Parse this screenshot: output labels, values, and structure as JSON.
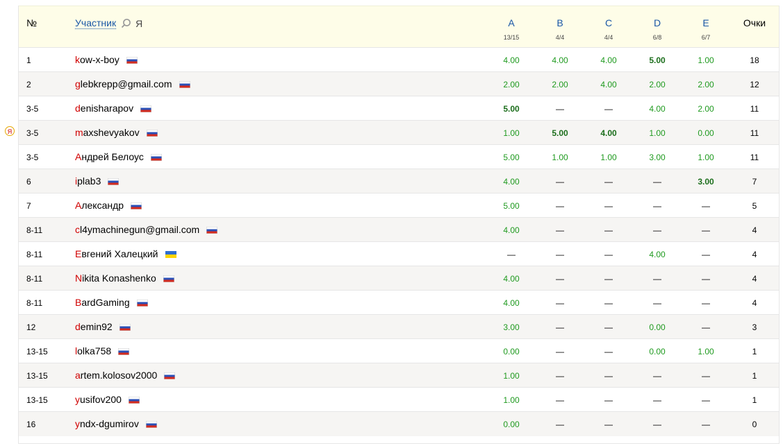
{
  "header": {
    "num_label": "№",
    "participant_label": "Участник",
    "me_label": "Я",
    "score_label": "Очки",
    "problems": [
      {
        "letter": "A",
        "stat": "13/15"
      },
      {
        "letter": "B",
        "stat": "4/4"
      },
      {
        "letter": "C",
        "stat": "4/4"
      },
      {
        "letter": "D",
        "stat": "6/8"
      },
      {
        "letter": "E",
        "stat": "6/7"
      }
    ]
  },
  "me_marker": "Я",
  "rows": [
    {
      "rank": "1",
      "first": "k",
      "rest": "ow-x-boy",
      "flag": "ru",
      "scores": [
        "4.00",
        "4.00",
        "4.00",
        "5.00",
        "1.00"
      ],
      "best": [
        false,
        false,
        false,
        true,
        false
      ],
      "total": "18"
    },
    {
      "rank": "2",
      "first": "g",
      "rest": "lebkrepp@gmail.com",
      "flag": "ru",
      "scores": [
        "2.00",
        "2.00",
        "4.00",
        "2.00",
        "2.00"
      ],
      "best": [
        false,
        false,
        false,
        false,
        false
      ],
      "total": "12"
    },
    {
      "rank": "3-5",
      "first": "d",
      "rest": "enisharapov",
      "flag": "ru",
      "scores": [
        "5.00",
        "—",
        "—",
        "4.00",
        "2.00"
      ],
      "best": [
        true,
        false,
        false,
        false,
        false
      ],
      "total": "11"
    },
    {
      "rank": "3-5",
      "first": "m",
      "rest": "axshevyakov",
      "flag": "ru",
      "scores": [
        "1.00",
        "5.00",
        "4.00",
        "1.00",
        "0.00"
      ],
      "best": [
        false,
        true,
        true,
        false,
        false
      ],
      "total": "11",
      "me": true
    },
    {
      "rank": "3-5",
      "first": "А",
      "rest": "ндрей Белоус",
      "flag": "ru",
      "scores": [
        "5.00",
        "1.00",
        "1.00",
        "3.00",
        "1.00"
      ],
      "best": [
        false,
        false,
        false,
        false,
        false
      ],
      "total": "11"
    },
    {
      "rank": "6",
      "first": "i",
      "rest": "plab3",
      "flag": "ru",
      "scores": [
        "4.00",
        "—",
        "—",
        "—",
        "3.00"
      ],
      "best": [
        false,
        false,
        false,
        false,
        true
      ],
      "total": "7"
    },
    {
      "rank": "7",
      "first": "А",
      "rest": "лександр",
      "flag": "ru",
      "scores": [
        "5.00",
        "—",
        "—",
        "—",
        "—"
      ],
      "best": [
        false,
        false,
        false,
        false,
        false
      ],
      "total": "5"
    },
    {
      "rank": "8-11",
      "first": "c",
      "rest": "l4ymachinegun@gmail.com",
      "flag": "ru",
      "scores": [
        "4.00",
        "—",
        "—",
        "—",
        "—"
      ],
      "best": [
        false,
        false,
        false,
        false,
        false
      ],
      "total": "4"
    },
    {
      "rank": "8-11",
      "first": "Е",
      "rest": "вгений Халецкий",
      "flag": "ua",
      "scores": [
        "—",
        "—",
        "—",
        "4.00",
        "—"
      ],
      "best": [
        false,
        false,
        false,
        false,
        false
      ],
      "total": "4"
    },
    {
      "rank": "8-11",
      "first": "N",
      "rest": "ikita Konashenko",
      "flag": "ru",
      "scores": [
        "4.00",
        "—",
        "—",
        "—",
        "—"
      ],
      "best": [
        false,
        false,
        false,
        false,
        false
      ],
      "total": "4"
    },
    {
      "rank": "8-11",
      "first": "B",
      "rest": "ardGaming",
      "flag": "ru",
      "scores": [
        "4.00",
        "—",
        "—",
        "—",
        "—"
      ],
      "best": [
        false,
        false,
        false,
        false,
        false
      ],
      "total": "4"
    },
    {
      "rank": "12",
      "first": "d",
      "rest": "emin92",
      "flag": "ru",
      "scores": [
        "3.00",
        "—",
        "—",
        "0.00",
        "—"
      ],
      "best": [
        false,
        false,
        false,
        false,
        false
      ],
      "total": "3"
    },
    {
      "rank": "13-15",
      "first": "l",
      "rest": "olka758",
      "flag": "ru",
      "scores": [
        "0.00",
        "—",
        "—",
        "0.00",
        "1.00"
      ],
      "best": [
        false,
        false,
        false,
        false,
        false
      ],
      "total": "1"
    },
    {
      "rank": "13-15",
      "first": "a",
      "rest": "rtem.kolosov2000",
      "flag": "ru",
      "scores": [
        "1.00",
        "—",
        "—",
        "—",
        "—"
      ],
      "best": [
        false,
        false,
        false,
        false,
        false
      ],
      "total": "1"
    },
    {
      "rank": "13-15",
      "first": "y",
      "rest": "usifov200",
      "flag": "ru",
      "scores": [
        "1.00",
        "—",
        "—",
        "—",
        "—"
      ],
      "best": [
        false,
        false,
        false,
        false,
        false
      ],
      "total": "1"
    },
    {
      "rank": "16",
      "first": "y",
      "rest": "ndx-dgumirov",
      "flag": "ru",
      "scores": [
        "0.00",
        "—",
        "—",
        "—",
        "—"
      ],
      "best": [
        false,
        false,
        false,
        false,
        false
      ],
      "total": "0"
    }
  ]
}
